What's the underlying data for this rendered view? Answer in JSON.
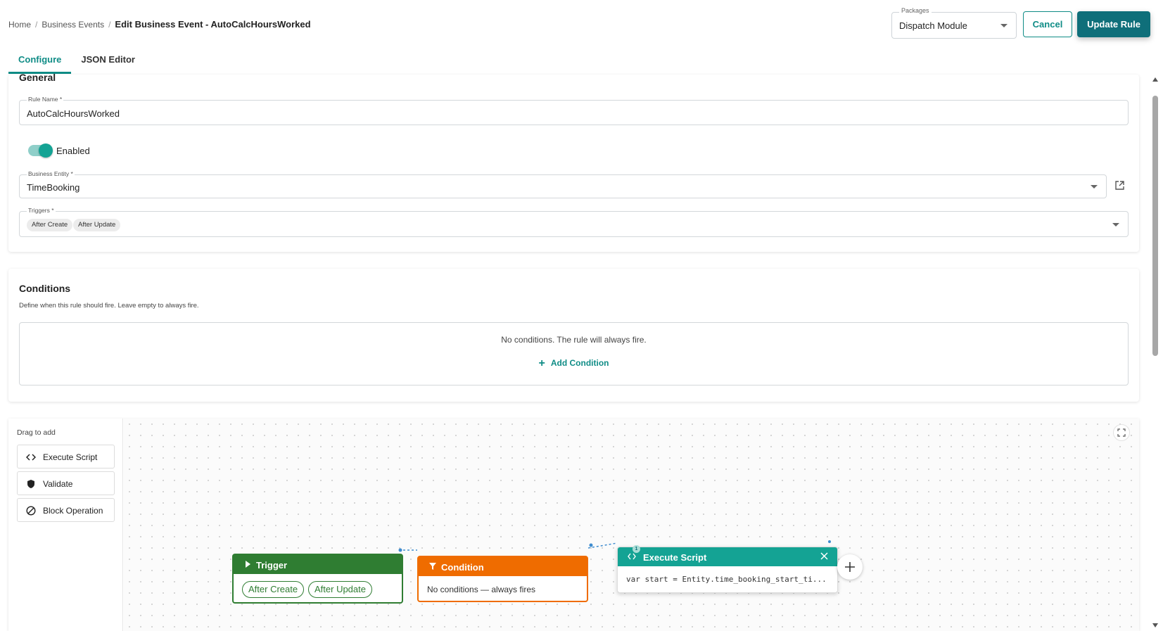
{
  "breadcrumb": {
    "home": "Home",
    "section": "Business Events",
    "current": "Edit Business Event - AutoCalcHoursWorked"
  },
  "header": {
    "packages_label": "Packages",
    "packages_value": "Dispatch Module",
    "cancel_label": "Cancel",
    "update_label": "Update Rule"
  },
  "tabs": [
    {
      "label": "Configure",
      "active": true
    },
    {
      "label": "JSON Editor",
      "active": false
    }
  ],
  "general": {
    "title": "General",
    "rule_name_label": "Rule Name *",
    "rule_name_value": "AutoCalcHoursWorked",
    "enabled_label": "Enabled",
    "enabled": true,
    "entity_label": "Business Entity *",
    "entity_value": "TimeBooking",
    "triggers_label": "Triggers *",
    "triggers": [
      "After Create",
      "After Update"
    ]
  },
  "conditions": {
    "title": "Conditions",
    "description": "Define when this rule should fire. Leave empty to always fire.",
    "empty_text": "No conditions. The rule will always fire.",
    "add_label": "Add Condition"
  },
  "builder": {
    "palette_title": "Drag to add",
    "palette_items": [
      {
        "label": "Execute Script",
        "icon": "code-icon"
      },
      {
        "label": "Validate",
        "icon": "shield-icon"
      },
      {
        "label": "Block Operation",
        "icon": "block-icon"
      }
    ],
    "trigger_node": {
      "title": "Trigger",
      "pills": [
        "After Create",
        "After Update"
      ]
    },
    "condition_node": {
      "title": "Condition",
      "body": "No conditions — always fires"
    },
    "script_node": {
      "title": "Execute Script",
      "badge": "1",
      "body": "var start = Entity.time_booking_start_ti..."
    }
  },
  "colors": {
    "accent": "#0f8c86",
    "primary_button": "#0f6f7a",
    "trigger": "#2f7d32",
    "condition": "#ef6c00",
    "script": "#14a394"
  }
}
